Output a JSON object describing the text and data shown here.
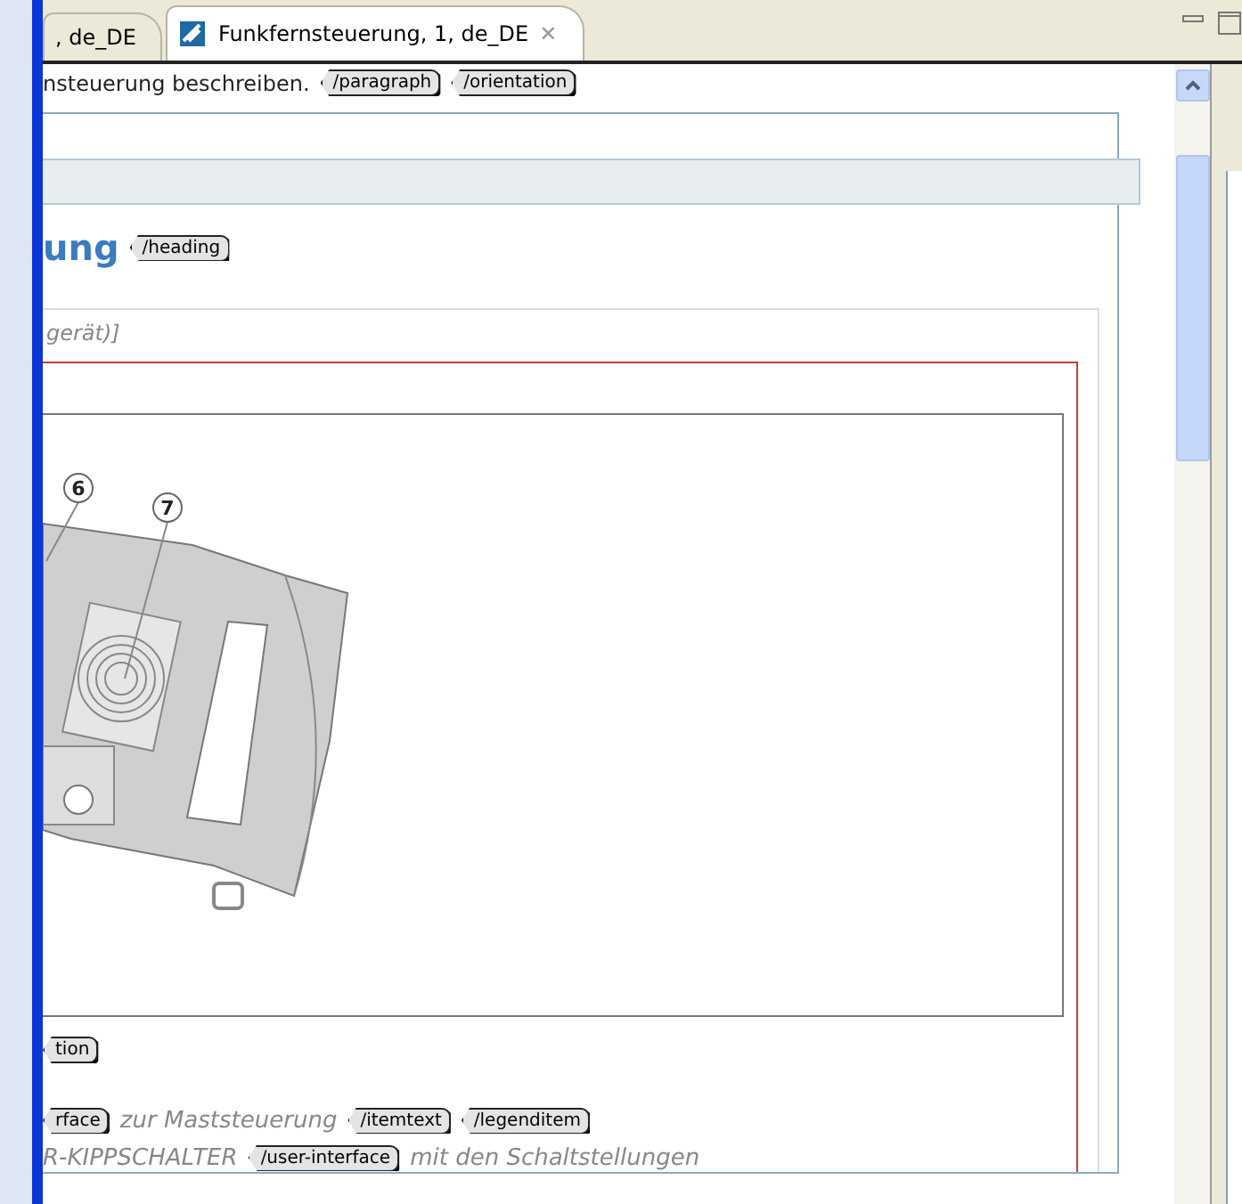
{
  "tabs": [
    {
      "label": ", de_DE",
      "selected": false
    },
    {
      "label": "Funkfernsteuerung, 1, de_DE",
      "selected": true,
      "close": "✕"
    }
  ],
  "top_line": {
    "text": "nsteuerung beschreiben.",
    "tags": [
      "/paragraph",
      "/orientation"
    ]
  },
  "heading": {
    "text": "ung",
    "tag": "/heading"
  },
  "caption": "gerät)]",
  "figure": {
    "callouts": [
      "6",
      "7"
    ]
  },
  "figure_tag": "tion",
  "lines": [
    {
      "parts": [
        {
          "kind": "tag",
          "text": "rface"
        },
        {
          "kind": "text",
          "text": "zur Maststeuerung"
        },
        {
          "kind": "tag",
          "text": "/itemtext"
        },
        {
          "kind": "tag",
          "text": "/legenditem"
        }
      ]
    },
    {
      "parts": [
        {
          "kind": "text",
          "text": "R-KIPPSCHALTER"
        },
        {
          "kind": "tag",
          "text": "/user-interface"
        },
        {
          "kind": "text",
          "text": "mit den Schaltstellungen"
        }
      ]
    }
  ]
}
